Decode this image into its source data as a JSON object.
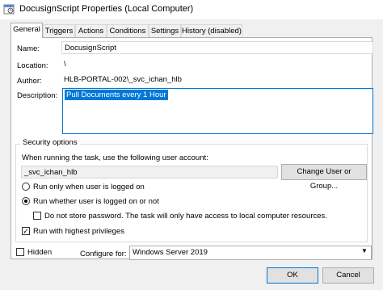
{
  "window": {
    "title": "DocusignScript Properties (Local Computer)"
  },
  "tabs": [
    {
      "label": "General"
    },
    {
      "label": "Triggers"
    },
    {
      "label": "Actions"
    },
    {
      "label": "Conditions"
    },
    {
      "label": "Settings"
    },
    {
      "label": "History (disabled)"
    }
  ],
  "general": {
    "name_label": "Name:",
    "name_value": "DocusignScript",
    "location_label": "Location:",
    "location_value": "\\",
    "author_label": "Author:",
    "author_value": "HLB-PORTAL-002\\_svc_ichan_hlb",
    "description_label": "Description:",
    "description_value": "Pull Documents every 1 Hour"
  },
  "security": {
    "title": "Security options",
    "account_prompt": "When running the task, use the following user account:",
    "account_value": "_svc_ichan_hlb",
    "change_button": "Change User or Group...",
    "radio_logged_on": "Run only when user is logged on",
    "radio_whether": "Run whether user is logged on or not",
    "no_store_password": "Do not store password.  The task will only have access to local computer resources.",
    "highest_privileges": "Run with highest privileges",
    "selected_option": "Run whether user is logged on or not",
    "no_store_checked": false,
    "highest_checked": true
  },
  "footer": {
    "hidden_label": "Hidden",
    "hidden_checked": false,
    "configure_label": "Configure for:",
    "configure_value": "Windows Server 2019",
    "ok_button": "OK",
    "cancel_button": "Cancel"
  }
}
